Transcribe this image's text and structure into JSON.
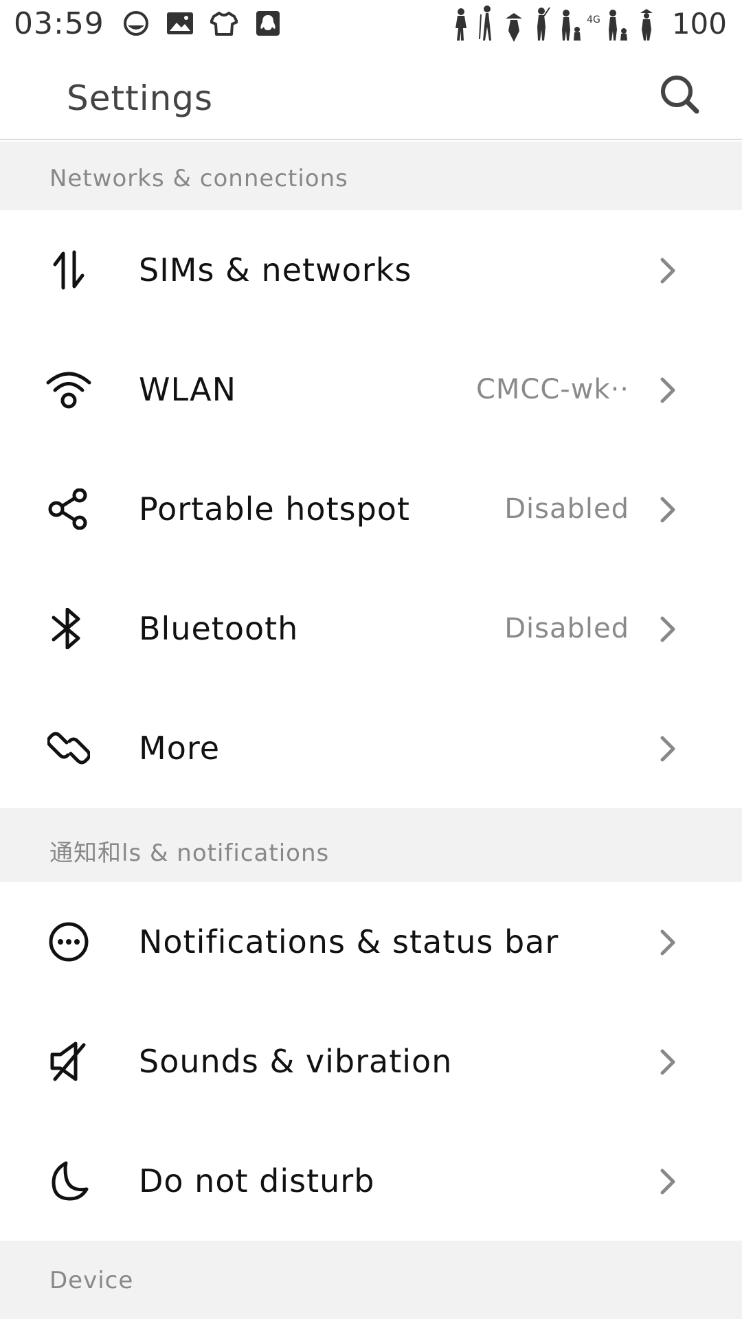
{
  "status_bar": {
    "time": "03:59",
    "network_type": "4G",
    "battery": "100",
    "icons": [
      "circle-face-icon",
      "image-icon",
      "shirt-icon",
      "qq-penguin-icon"
    ]
  },
  "app_bar": {
    "title": "Settings",
    "search_icon": "search-icon"
  },
  "sections": [
    {
      "header": "Networks & connections",
      "items": [
        {
          "label": "SIMs & networks",
          "value": "",
          "icon": "sim-data-arrows-icon"
        },
        {
          "label": "WLAN",
          "value": "CMCC-wk··",
          "icon": "wifi-icon"
        },
        {
          "label": "Portable hotspot",
          "value": "Disabled",
          "icon": "share-hotspot-icon"
        },
        {
          "label": "Bluetooth",
          "value": "Disabled",
          "icon": "bluetooth-icon"
        },
        {
          "label": "More",
          "value": "",
          "icon": "link-icon"
        }
      ]
    },
    {
      "header": "通知和ls & notifications",
      "items": [
        {
          "label": "Notifications & status bar",
          "value": "",
          "icon": "chat-dots-icon"
        },
        {
          "label": "Sounds & vibration",
          "value": "",
          "icon": "speaker-muted-icon"
        },
        {
          "label": "Do not disturb",
          "value": "",
          "icon": "moon-icon"
        }
      ]
    },
    {
      "header": "Device",
      "items": []
    }
  ],
  "colors": {
    "section_background": "#f2f2f2",
    "header_text": "#888888",
    "value_text": "#8a8a8a",
    "label_text": "#111111",
    "chevron": "#888888"
  }
}
